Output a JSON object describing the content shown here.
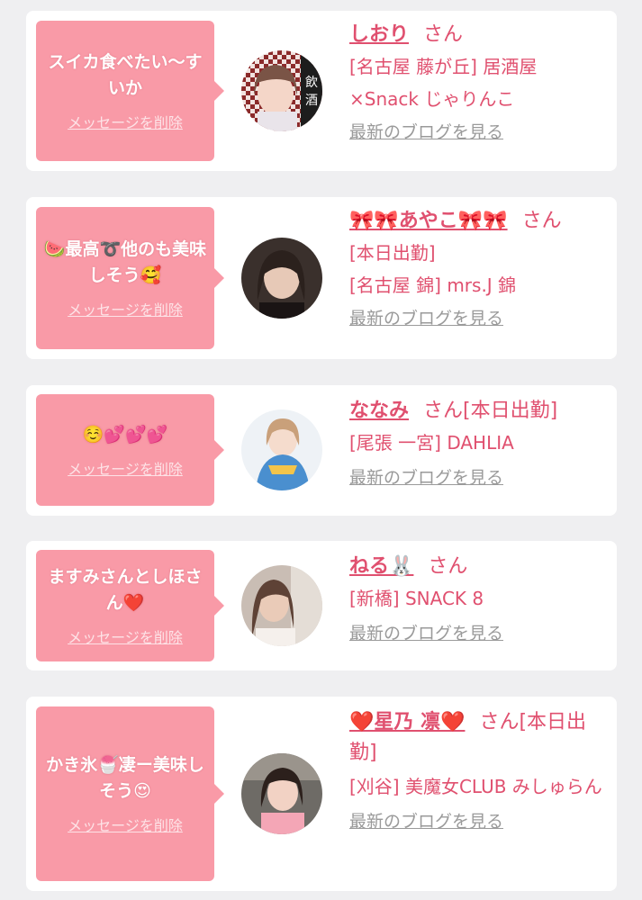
{
  "delete_label": "メッセージを削除",
  "blog_label": "最新のブログを見る",
  "san": "さん",
  "cards": [
    {
      "message": "スイカ食べたい〜すいか",
      "name": "しおり",
      "shop_lines": [
        "[名古屋 藤が丘] 居酒屋",
        "×Snack じゃりんこ"
      ],
      "avatar_sign": "飲酒"
    },
    {
      "message": "🍉最高➰他のも美味しそう🥰",
      "name": "🎀🎀あやこ🎀🎀",
      "shop_lines": [
        "[本日出勤]",
        "[名古屋 錦] mrs.J 錦"
      ]
    },
    {
      "message": "☺️💕💕💕",
      "name": "ななみ",
      "name_suffix": "[本日出勤]",
      "shop_lines": [
        "[尾張 一宮] DAHLIA"
      ]
    },
    {
      "message": "ますみさんとしほさん❤️",
      "name": "ねる🐰",
      "shop_lines": [
        "[新橋] SNACK 8"
      ]
    },
    {
      "message": "かき氷🍧凄ー美味しそう😍",
      "name": "❤️星乃 凛❤️",
      "name_suffix": "[本日出勤]",
      "shop_lines": [
        "[刈谷] 美魔女CLUB みしゅらん"
      ]
    }
  ],
  "colors": {
    "background": "#efeff1",
    "bubble": "#f99aa7",
    "accent_text": "#e0506f",
    "link_gray": "#9a9a9a"
  }
}
